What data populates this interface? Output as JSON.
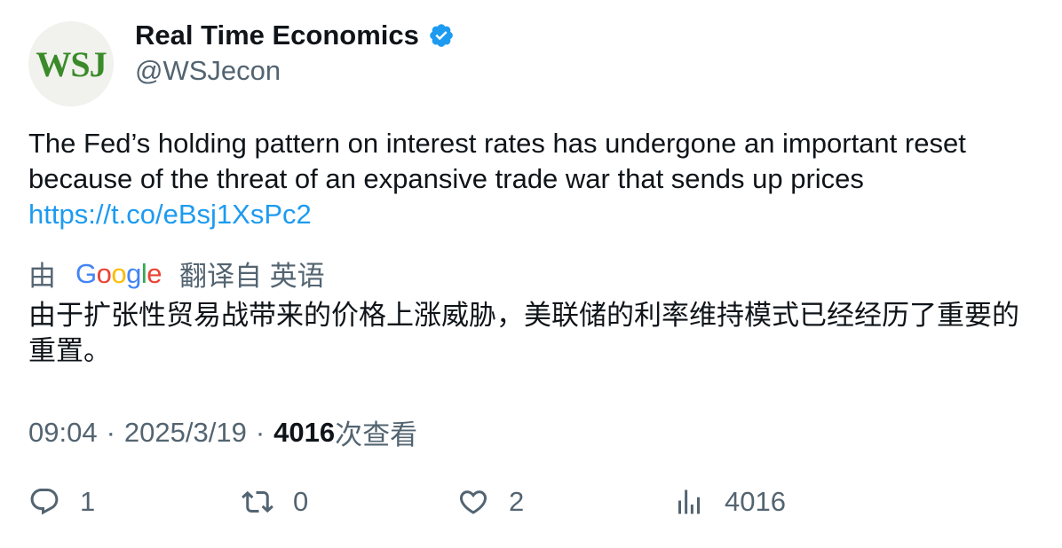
{
  "author": {
    "avatar_text": "WSJ",
    "name": "Real Time Economics",
    "handle": "@WSJecon",
    "verified": true
  },
  "tweet": {
    "text": "The Fed’s holding pattern on interest rates has undergone an important reset because of the threat of an expansive trade war that sends up prices",
    "link": "https://t.co/eBsj1XsPc2"
  },
  "translation": {
    "prefix": "由",
    "provider": "Google",
    "suffix": "翻译自 英语",
    "text": "由于扩张性贸易战带来的价格上涨威胁，美联储的利率维持模式已经经历了重要的重置。"
  },
  "meta": {
    "time": "09:04",
    "separator": "·",
    "date": "2025/3/19",
    "views_count": "4016",
    "views_label": "次查看"
  },
  "actions": {
    "replies": "1",
    "retweets": "0",
    "likes": "2",
    "views": "4016"
  },
  "colors": {
    "text": "#0f1419",
    "secondary": "#536471",
    "link": "#1d9bf0",
    "verified": "#1d9bf0",
    "avatar_bg": "#f1f1ed",
    "avatar_text": "#3a8a2a"
  }
}
